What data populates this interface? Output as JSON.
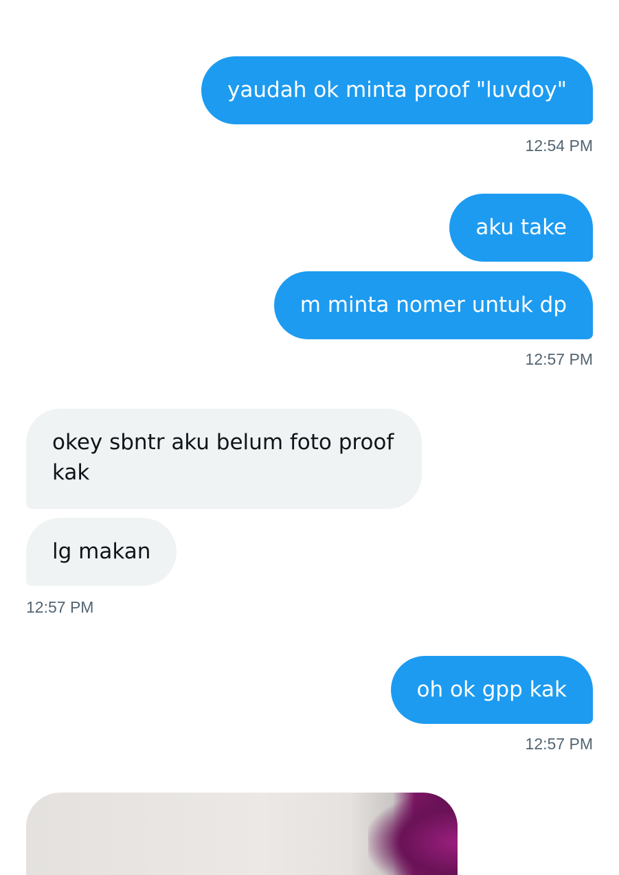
{
  "messages": [
    {
      "direction": "sent",
      "text": "yaudah ok minta proof \"luvdoy\""
    },
    {
      "direction": "sent",
      "text": "aku take"
    },
    {
      "direction": "sent",
      "text": "m minta nomer untuk dp"
    },
    {
      "direction": "received",
      "text": "okey sbntr aku belum foto proof kak"
    },
    {
      "direction": "received",
      "text": "lg makan"
    },
    {
      "direction": "sent",
      "text": "oh ok gpp kak"
    }
  ],
  "timestamps": [
    "12:54 PM",
    "12:57 PM",
    "12:57 PM",
    "12:57 PM"
  ],
  "colors": {
    "sent_bubble": "#1d9bf0",
    "received_bubble": "#eff3f4",
    "timestamp_text": "#536471"
  }
}
